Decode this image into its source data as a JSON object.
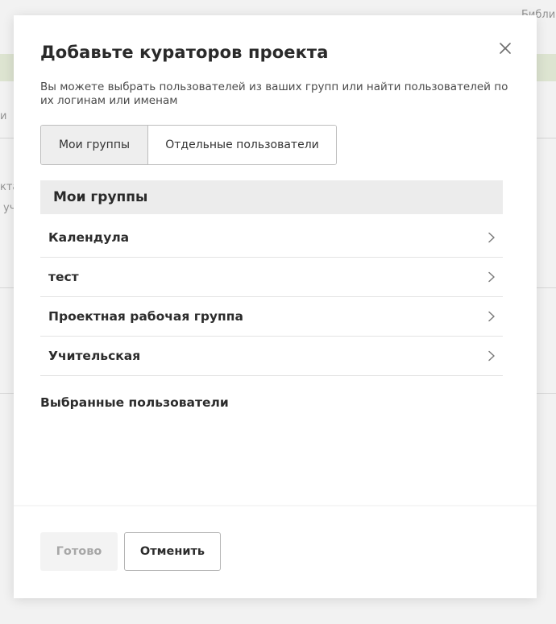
{
  "background": {
    "top_right_text": "Библи",
    "left_fragment_1": "и",
    "left_fragment_2": "кта",
    "left_fragment_3": "уч"
  },
  "modal": {
    "title": "Добавьте кураторов проекта",
    "close_icon": "close-icon",
    "subtitle": "Вы можете выбрать пользователей из ваших групп или найти пользователей по их логинам или именам",
    "tabs": [
      {
        "label": "Мои группы",
        "active": true
      },
      {
        "label": "Отдельные пользователи",
        "active": false
      }
    ],
    "groups_section": {
      "header": "Мои группы",
      "items": [
        {
          "label": "Календула",
          "icon": "chevron-right-icon"
        },
        {
          "label": "тест",
          "icon": "chevron-right-icon"
        },
        {
          "label": "Проектная рабочая группа",
          "icon": "chevron-right-icon"
        },
        {
          "label": "Учительская",
          "icon": "chevron-right-icon"
        }
      ]
    },
    "selected_users_title": "Выбранные пользователи",
    "buttons": {
      "done_label": "Готово",
      "done_disabled": true,
      "cancel_label": "Отменить"
    }
  },
  "colors": {
    "header_bg": "#ececec",
    "active_tab_bg": "#eeeeee",
    "disabled_text": "#a7a7a7",
    "background_accent": "#e9f1dc"
  }
}
